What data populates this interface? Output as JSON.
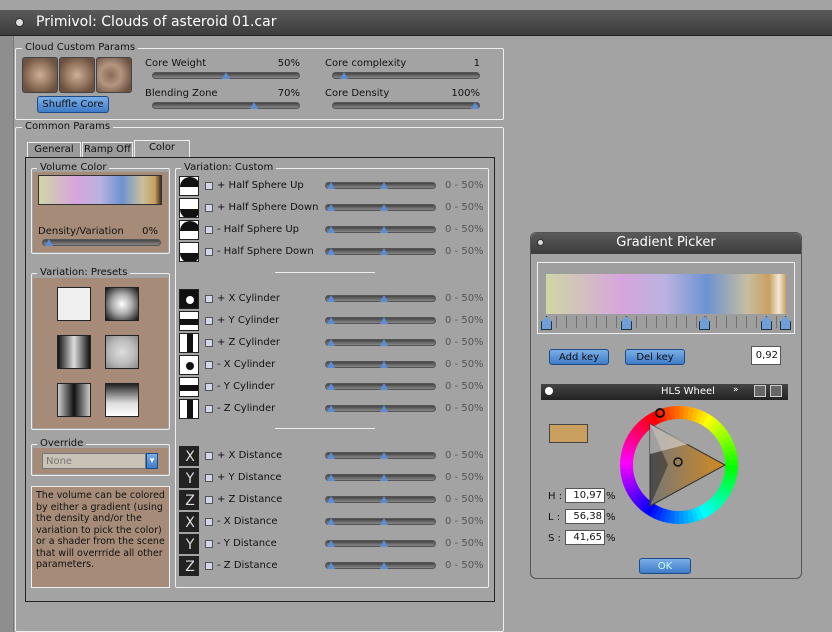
{
  "window": {
    "title": "Primivol: Clouds of asteroid 01.car"
  },
  "cloud_params": {
    "label": "Cloud Custom Params",
    "shuffle_label": "Shuffle Core",
    "sliders": [
      {
        "label": "Core Weight",
        "value": "50%",
        "fraction": 0.5
      },
      {
        "label": "Core complexity",
        "value": "1",
        "fraction": 0.05
      },
      {
        "label": "Blending Zone",
        "value": "70%",
        "fraction": 0.7
      },
      {
        "label": "Core Density",
        "value": "100%",
        "fraction": 1.0
      }
    ]
  },
  "common": {
    "label": "Common Params",
    "tabs": [
      {
        "label": "General"
      },
      {
        "label": "Ramp Off"
      },
      {
        "label": "Color"
      }
    ],
    "active_tab": "Color"
  },
  "volume_color": {
    "label": "Volume Color",
    "density_label": "Density/Variation",
    "density_value": "0%",
    "density_fraction": 0.05
  },
  "presets": {
    "label": "Variation: Presets"
  },
  "override": {
    "label": "Override",
    "value": "None"
  },
  "help_text": "The volume can be colored by either a gradient (using the density and/or the variation to pick the color) or a shader from the scene that will overrride all other parameters.",
  "variation": {
    "label": "Variation: Custom",
    "range_text": "0 - 50%",
    "groups": [
      {
        "rows": [
          {
            "label": "+ Half Sphere Up",
            "icon": "half-sphere-up-icon"
          },
          {
            "label": "+ Half Sphere Down",
            "icon": "half-sphere-down-icon"
          },
          {
            "label": "- Half Sphere Up",
            "icon": "half-sphere-up-icon"
          },
          {
            "label": "- Half Sphere Down",
            "icon": "half-sphere-down-icon"
          }
        ]
      },
      {
        "rows": [
          {
            "label": "+ X Cylinder",
            "icon": "x-cylinder-icon"
          },
          {
            "label": "+ Y Cylinder",
            "icon": "y-cylinder-icon"
          },
          {
            "label": "+ Z Cylinder",
            "icon": "z-cylinder-icon"
          },
          {
            "label": "- X Cylinder",
            "icon": "x-cylinder-icon"
          },
          {
            "label": "- Y Cylinder",
            "icon": "y-cylinder-icon"
          },
          {
            "label": "- Z Cylinder",
            "icon": "z-cylinder-icon"
          }
        ]
      },
      {
        "rows": [
          {
            "label": "+ X Distance",
            "icon": "x-distance-icon",
            "glyph": "X"
          },
          {
            "label": "+ Y Distance",
            "icon": "y-distance-icon",
            "glyph": "Y"
          },
          {
            "label": "+ Z Distance",
            "icon": "z-distance-icon",
            "glyph": "Z"
          },
          {
            "label": "- X Distance",
            "icon": "x-distance-icon",
            "glyph": "X"
          },
          {
            "label": "- Y Distance",
            "icon": "y-distance-icon",
            "glyph": "Y"
          },
          {
            "label": "- Z Distance",
            "icon": "z-distance-icon",
            "glyph": "Z"
          }
        ]
      }
    ]
  },
  "gradient_picker": {
    "title": "Gradient Picker",
    "add_key": "Add key",
    "del_key": "Del key",
    "key_value": "0,92",
    "wheel_label": "HLS Wheel",
    "h_label": "H :",
    "h_value": "10,97",
    "h_unit": "%",
    "l_label": "L :",
    "l_value": "56,38",
    "l_unit": "%",
    "s_label": "S :",
    "s_value": "41,65",
    "s_unit": "%",
    "ok_label": "OK",
    "swatch_color": "#c9a060"
  }
}
